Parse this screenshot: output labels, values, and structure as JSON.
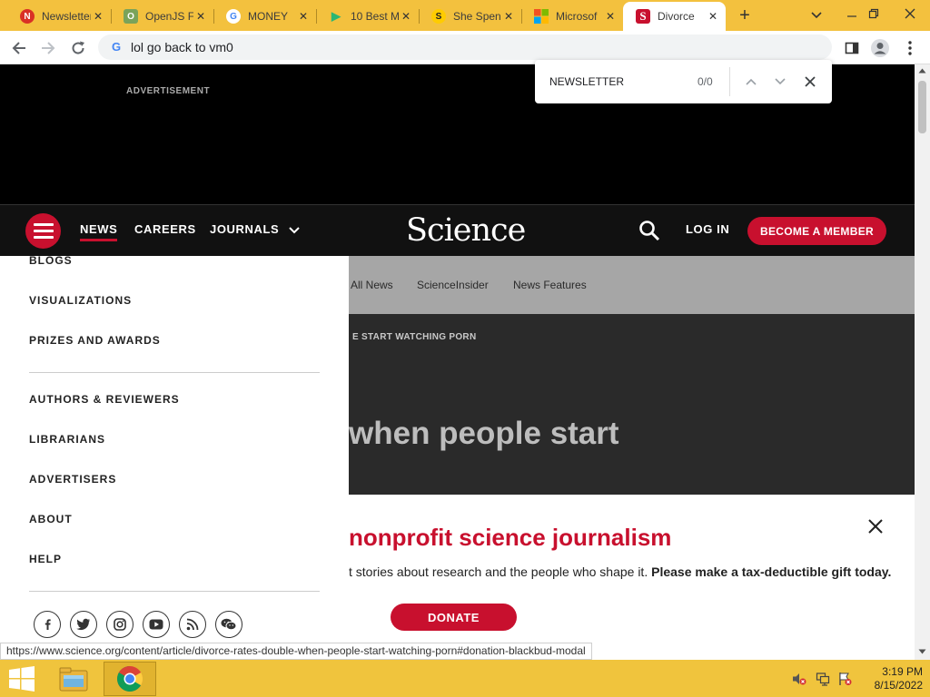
{
  "browser": {
    "tabs": [
      {
        "title": "Newsletter",
        "favicon_color": "#d93025",
        "favicon_glyph": "N"
      },
      {
        "title": "OpenJS F",
        "favicon_color": "#7aa35a",
        "favicon_glyph": "O"
      },
      {
        "title": "MONEY",
        "favicon_color": "#4285f4",
        "favicon_glyph": "G"
      },
      {
        "title": "10 Best M",
        "favicon_color": "#2bb673",
        "favicon_glyph": "▶"
      },
      {
        "title": "She Spen",
        "favicon_color": "#ffcc00",
        "favicon_glyph": "S"
      },
      {
        "title": "Microsof",
        "favicon_color": "#00a4ef",
        "favicon_glyph": "■"
      },
      {
        "title": "Divorce",
        "favicon_color": "#c8102e",
        "favicon_glyph": "S"
      }
    ],
    "new_tab": "+",
    "omnibox_value": "lol go back to vm0",
    "find": {
      "query": "NEWSLETTER",
      "count": "0/0"
    }
  },
  "page": {
    "advertisement_label": "ADVERTISEMENT",
    "nav": {
      "news": "NEWS",
      "careers": "CAREERS",
      "journals": "JOURNALS",
      "logo": "Science",
      "login": "LOG IN",
      "member": "BECOME A MEMBER"
    },
    "subnav": [
      "All News",
      "ScienceInsider",
      "News Features"
    ],
    "hero": {
      "kicker": "E START WATCHING PORN",
      "headline": "when people start"
    },
    "donate": {
      "headline": "nonprofit science journalism",
      "text": "t stories about research and the people who shape it. ",
      "text_bold": "Please make a tax-deductible gift today.",
      "button": "DONATE"
    },
    "menu": {
      "items_top": [
        "BLOGS",
        "VISUALIZATIONS",
        "PRIZES AND AWARDS"
      ],
      "items_bottom": [
        "AUTHORS & REVIEWERS",
        "LIBRARIANS",
        "ADVERTISERS",
        "ABOUT",
        "HELP"
      ]
    }
  },
  "status_url": "https://www.science.org/content/article/divorce-rates-double-when-people-start-watching-porn#donation-blackbud-modal",
  "taskbar": {
    "time": "3:19 PM",
    "date": "8/15/2022"
  },
  "colors": {
    "accent": "#c8102e",
    "taskbar": "#f0c43d"
  }
}
